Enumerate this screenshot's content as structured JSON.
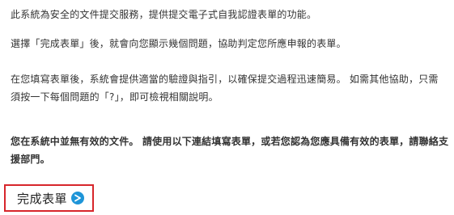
{
  "paragraphs": {
    "p1": "此系統為安全的文件提交服務，提供提交電子式自我認證表單的功能。",
    "p2": "選擇「完成表單」後，就會向您顯示幾個問題，協助判定您所應申報的表單。",
    "p3": "在您填寫表單後，系統會提供適當的驗證與指引，以確保提交過程迅速簡易。 如需其他協助，只需須按一下每個問題的「?」，即可檢視相關說明。",
    "p4": "您在系統中並無有效的文件。 請使用以下連結填寫表單，或若您認為您應具備有效的表單，請聯絡支援部門。"
  },
  "complete_form": {
    "label": "完成表單",
    "icon": "arrow-right-circle-icon",
    "accent_color": "#1e95d8",
    "highlight_color": "#d7262b"
  }
}
